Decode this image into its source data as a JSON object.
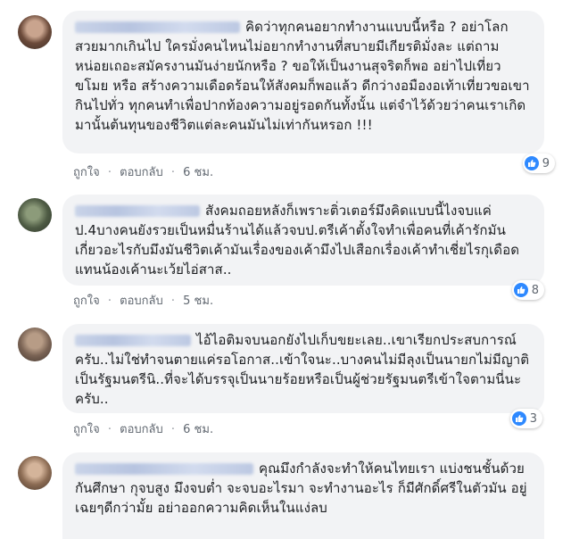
{
  "comments": [
    {
      "text": "คิดว่าทุกคนอยากทำงานแบบนี้หรือ ? อย่าโลกสวยมากเกินไป ใครมั่งคนไหนไม่อยากทำงานที่สบายมีเกียรติมั่งละ แต่ถามหน่อยเถอะสมัครงานมันง่ายนักหรือ ? ขอให้เป็นงานสุจริตก็พอ อย่าไปเที่ยวขโมย หรือ สร้างความเดือดร้อนให้สังคมก็พอแล้ว ดีกว่างอมืองอเท้าเที่ยวขอเขากินไปทั่ว ทุกคนทำเพื่อปากท้องความอยู่รอดกันทั้งนั้น แต่จำไว้ด้วยว่าคนเราเกิดมานั้นต้นทุนของชีวิตแต่ละคนมันไม่เท่ากันหรอก !!!",
      "like": "ถูกใจ",
      "reply": "ตอบกลับ",
      "time": "6 ชม.",
      "reactions": "9"
    },
    {
      "text": "สังคมถอยหลังก็เพราะติ่วเตอร์มึงคิดแบบนี้ไงจบแค่ป.4บางคนยังรวยเป็นหมื่นร้านได้แล้วจบป.ตรีเค้าตั้งใจทำเพื่อคนที่เค้ารักมันเกี่ยวอะไรกับมึงมันชีวิตเค้ามันเรื่องของเค้ามึงไปเสือกเรื่องเค้าทำเชี่ยไรกุเดือดแทนน้องเค้านะเว้ยไอ่สาส..",
      "like": "ถูกใจ",
      "reply": "ตอบกลับ",
      "time": "5 ชม.",
      "reactions": "8"
    },
    {
      "text": "ไอ้ไอติมจบนอกยังไปเก็บขยะเลย..เขาเรียกประสบการณ์ครับ..ไม่ใช่ทำจนตายแค่รอโอกาส..เข้าใจนะ..บางคนไม่มีลุงเป็นนายกไม่มีญาติเป็นรัฐมนตรีนิ..ที่จะได้บรรจุเป็นนายร้อยหรือเป็นผู้ช่วยรัฐมนตรีเข้าใจตามนี่นะครับ..",
      "like": "ถูกใจ",
      "reply": "ตอบกลับ",
      "time": "6 ชม.",
      "reactions": "3"
    },
    {
      "text": "คุณมึงกำลังจะทำให้คนไทยเรา แบ่งชนชั้นด้วยกันศึกษา กุจบสูง มึงจบต่ำ จะจบอะไรมา จะทำงานอะไร ก็มีศักดิ์ศรีในตัวมัน อยู่เฉยๆดีกว่ามั้ย อย่าออกความคิดเห็นในแง่ลบ"
    }
  ],
  "separator": "·"
}
